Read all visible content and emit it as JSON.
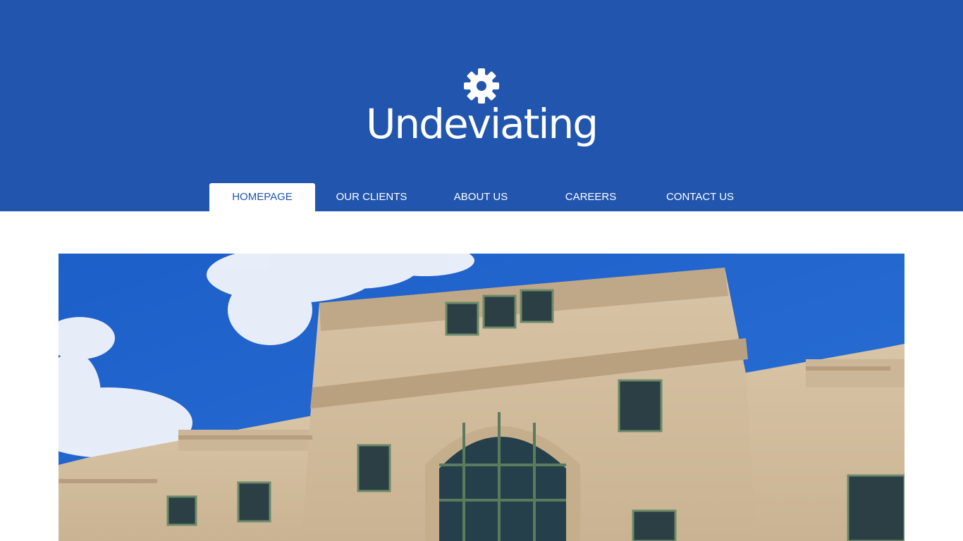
{
  "brand": {
    "name": "Undeviating",
    "icon": "gear-icon",
    "color": "#2155ae"
  },
  "nav": {
    "items": [
      {
        "label": "HOMEPAGE",
        "active": true
      },
      {
        "label": "OUR CLIENTS",
        "active": false
      },
      {
        "label": "ABOUT US",
        "active": false
      },
      {
        "label": "CAREERS",
        "active": false
      },
      {
        "label": "CONTACT US",
        "active": false
      }
    ]
  },
  "hero": {
    "description": "building facade under blue sky"
  }
}
